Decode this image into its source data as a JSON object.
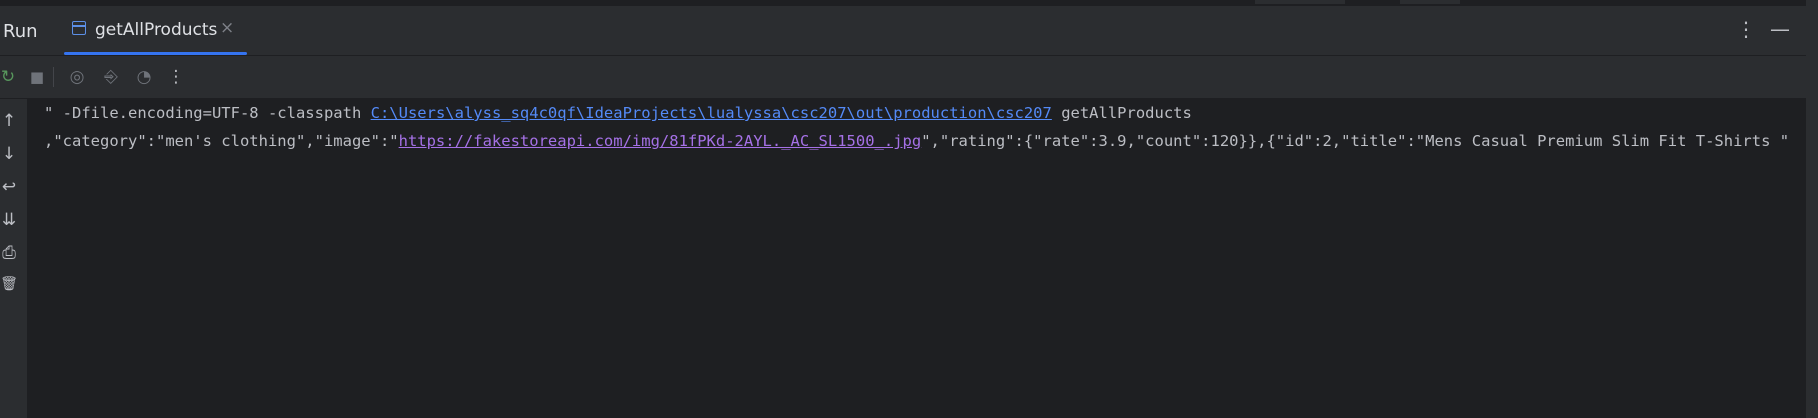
{
  "header": {
    "panel_title": "Run",
    "tab_label": "getAllProducts",
    "tab_close": "×",
    "more_glyph": "⋮",
    "minimize_glyph": "—"
  },
  "toolbar": {
    "rerun_glyph": "↻",
    "stop_glyph": "■",
    "screenshot_glyph": "◎",
    "restore_glyph": "⎆",
    "coverage_glyph": "◔",
    "more_glyph": "⋮"
  },
  "gutter": {
    "up_glyph": "↑",
    "down_glyph": "↓",
    "wrap_glyph": "↩",
    "scroll_end_glyph": "⇊",
    "print_glyph": "⎙",
    "trash_glyph": "🗑"
  },
  "console": {
    "line1_prefix": "\" -Dfile.encoding=UTF-8 -classpath ",
    "line1_link": "C:\\Users\\alyss_sq4c0qf\\IdeaProjects\\lualyssa\\csc207\\out\\production\\csc207",
    "line1_suffix": " getAllProducts",
    "line2_prefix": ",\"category\":\"men's clothing\",\"image\":\"",
    "line2_link": "https://fakestoreapi.com/img/81fPKd-2AYL._AC_SL1500_.jpg",
    "line2_suffix": "\",\"rating\":{\"rate\":3.9,\"count\":120}},{\"id\":2,\"title\":\"Mens Casual Premium Slim Fit T-Shirts \""
  },
  "colors": {
    "background": "#1e1f22",
    "panel": "#2b2d30",
    "accent": "#3574f0",
    "link": "#548af7",
    "visited_link": "#a571e6"
  }
}
